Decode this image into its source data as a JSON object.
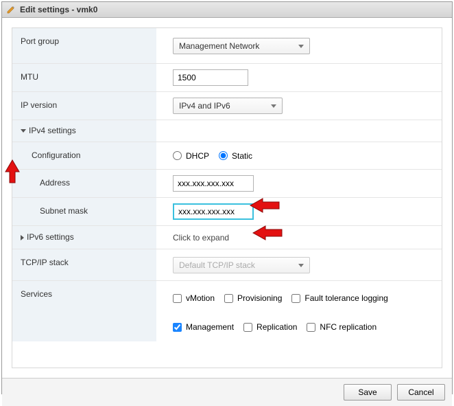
{
  "title": "Edit settings - vmk0",
  "labels": {
    "port_group": "Port group",
    "mtu": "MTU",
    "ip_version": "IP version",
    "ipv4_settings": "IPv4 settings",
    "configuration": "Configuration",
    "address": "Address",
    "subnet_mask": "Subnet mask",
    "ipv6_settings": "IPv6 settings",
    "tcpip_stack": "TCP/IP stack",
    "services": "Services"
  },
  "values": {
    "port_group_selected": "Management Network",
    "mtu": "1500",
    "ip_version_selected": "IPv4 and IPv6",
    "config_dhcp_label": "DHCP",
    "config_static_label": "Static",
    "config_selected": "static",
    "address": "xxx.xxx.xxx.xxx",
    "subnet_mask": "xxx.xxx.xxx.xxx",
    "ipv6_expand_hint": "Click to expand",
    "tcpip_selected": "Default TCP/IP stack"
  },
  "services": {
    "vmotion": {
      "label": "vMotion",
      "checked": false
    },
    "provisioning": {
      "label": "Provisioning",
      "checked": false
    },
    "ft_logging": {
      "label": "Fault tolerance logging",
      "checked": false
    },
    "management": {
      "label": "Management",
      "checked": true
    },
    "replication": {
      "label": "Replication",
      "checked": false
    },
    "nfc_replication": {
      "label": "NFC replication",
      "checked": false
    }
  },
  "buttons": {
    "save": "Save",
    "cancel": "Cancel"
  }
}
